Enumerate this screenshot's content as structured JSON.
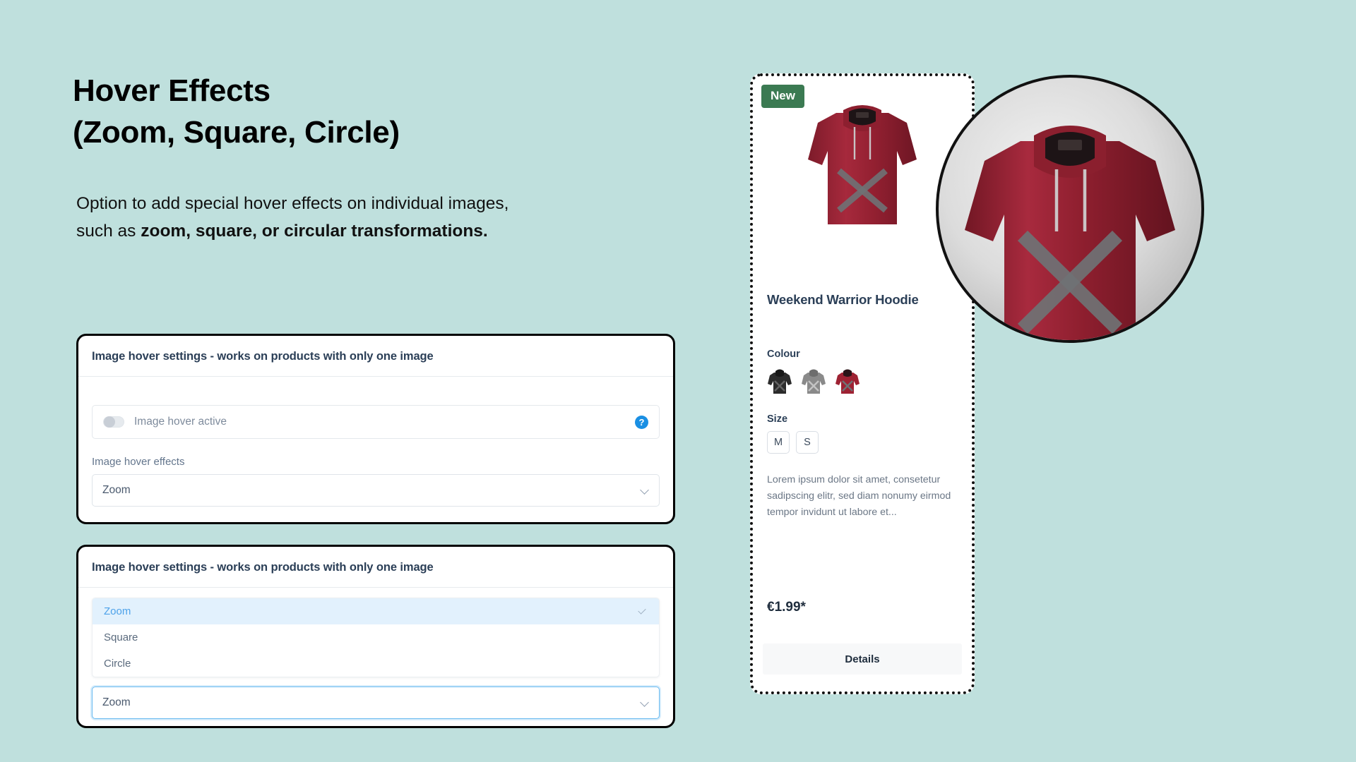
{
  "theme": {
    "background": "#bfe0dd",
    "badge_green": "#3b7a52",
    "accent_blue": "#4da2ea",
    "help_blue": "#1a8fe3",
    "heading_color": "#000000"
  },
  "headline": {
    "line1": "Hover Effects",
    "line2": "(Zoom, Square, Circle)"
  },
  "lede": {
    "part1": "Option to add special hover effects on individual images,",
    "part2_plain": "such as ",
    "part2_bold": "zoom, square, or circular transformations."
  },
  "card_one": {
    "header": "Image hover settings - works on products with only one image",
    "toggle_label": "Image hover active",
    "toggle_state": "off",
    "help_icon": "question-icon",
    "help_glyph": "?",
    "field_label": "Image hover effects",
    "select_value": "Zoom",
    "chevron_icon": "chevron-down-icon"
  },
  "card_two": {
    "header": "Image hover settings - works on products with only one image",
    "options": [
      {
        "label": "Zoom",
        "selected": true
      },
      {
        "label": "Square",
        "selected": false
      },
      {
        "label": "Circle",
        "selected": false
      }
    ],
    "select_value": "Zoom",
    "select_focused": true,
    "check_icon": "check-icon",
    "chevron_icon": "chevron-down-icon"
  },
  "product": {
    "badge": "New",
    "title": "Weekend Warrior Hoodie",
    "colour_label": "Colour",
    "colours": [
      {
        "name": "black",
        "hex": "#2b2b2b"
      },
      {
        "name": "grey",
        "hex": "#8a8a8a"
      },
      {
        "name": "red",
        "hex": "#9e2233"
      }
    ],
    "size_label": "Size",
    "sizes": [
      "M",
      "S"
    ],
    "description": "Lorem ipsum dolor sit amet, consetetur sadipscing elitr, sed diam nonumy eirmod tempor invidunt ut labore et...",
    "price": "€1.99*",
    "details_button": "Details"
  },
  "zoom_preview": {
    "icon": "zoom-circle-preview"
  }
}
